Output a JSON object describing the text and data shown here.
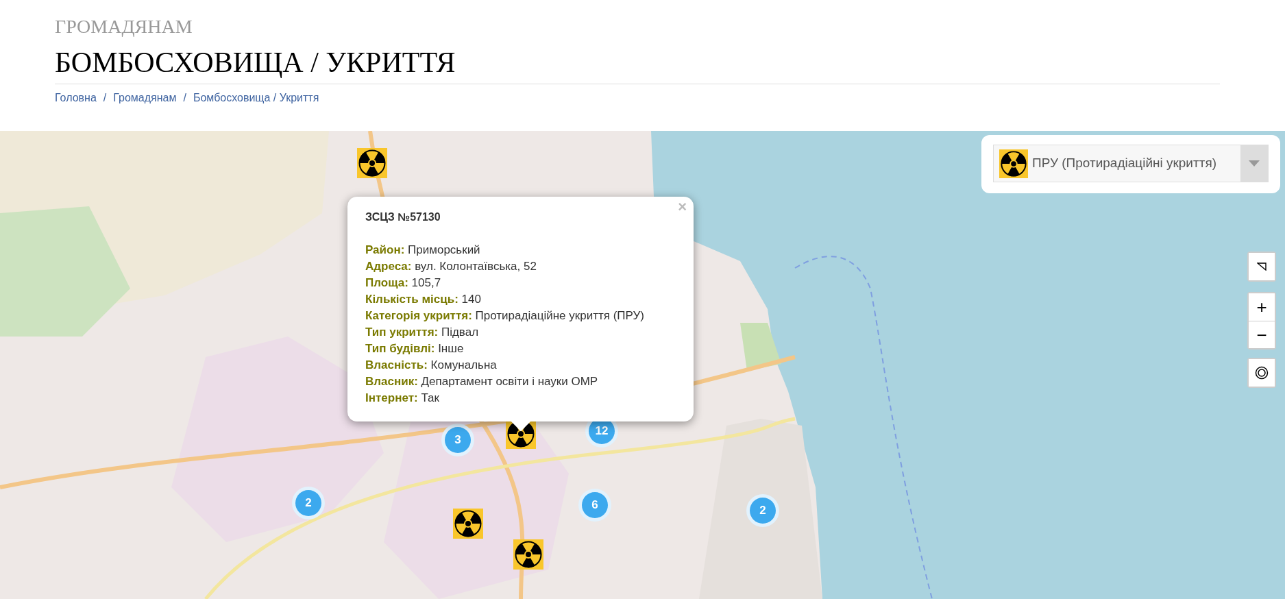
{
  "header": {
    "section": "ГРОМАДЯНАМ",
    "title": "БОМБОСХОВИЩА / УКРИТТЯ"
  },
  "breadcrumb": [
    {
      "kind": "link",
      "text": "Головна"
    },
    {
      "kind": "separator",
      "text": "/"
    },
    {
      "kind": "link",
      "text": "Громадянам"
    },
    {
      "kind": "separator",
      "text": "/"
    },
    {
      "kind": "link",
      "text": "Бомбосховища / Укриття"
    }
  ],
  "map": {
    "filter": {
      "value": "ПРУ (Протирадіаційні укриття)"
    },
    "zoom_controls": [
      "+",
      "−"
    ],
    "clusters": [
      {
        "count": "3"
      },
      {
        "count": "12"
      },
      {
        "count": "2"
      },
      {
        "count": "6"
      },
      {
        "count": "2"
      }
    ],
    "popup": {
      "title": "ЗСЦЗ №57130",
      "close": "×",
      "fields": [
        {
          "label": "Район:",
          "value": "Приморський"
        },
        {
          "label": "Адреса:",
          "value": "вул. Колонтаївська, 52"
        },
        {
          "label": "Площа:",
          "value": "105,7"
        },
        {
          "label": "Кількість місць:",
          "value": "140"
        },
        {
          "label": "Категорія укриття:",
          "value": "Протирадіаційне укриття (ПРУ)"
        },
        {
          "label": "Тип укриття:",
          "value": "Підвал"
        },
        {
          "label": "Тип будівлі:",
          "value": "Інше"
        },
        {
          "label": "Власність:",
          "value": "Комунальна"
        },
        {
          "label": "Власник:",
          "value": "Департамент освіти і науки ОМР"
        },
        {
          "label": "Інтернет:",
          "value": "Так"
        }
      ]
    }
  }
}
